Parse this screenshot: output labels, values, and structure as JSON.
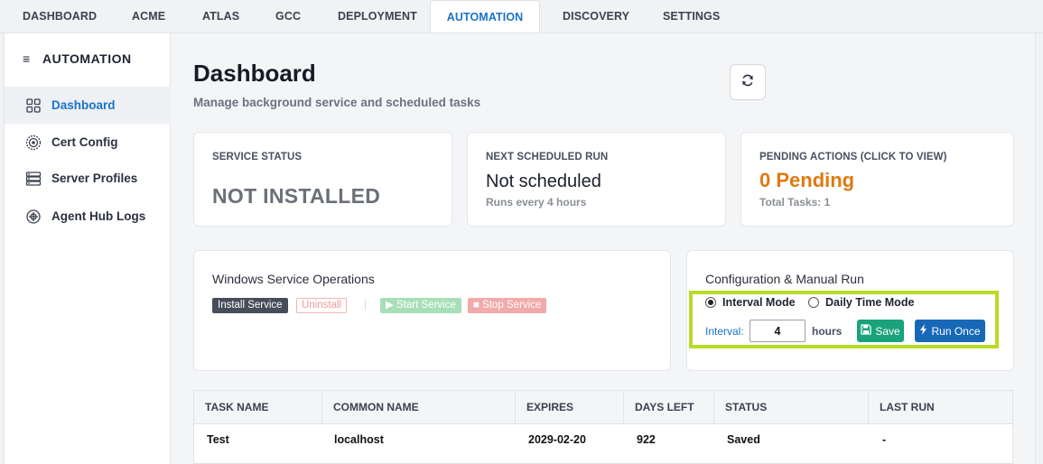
{
  "topnav": {
    "tabs": [
      {
        "label": "DASHBOARD"
      },
      {
        "label": "ACME"
      },
      {
        "label": "ATLAS"
      },
      {
        "label": "GCC"
      },
      {
        "label": "DEPLOYMENT"
      },
      {
        "label": "AUTOMATION",
        "active": true
      },
      {
        "label": "DISCOVERY"
      },
      {
        "label": "SETTINGS"
      }
    ]
  },
  "sidebar": {
    "title": "AUTOMATION",
    "items": [
      {
        "label": "Dashboard",
        "icon": "grid-icon",
        "active": true
      },
      {
        "label": "Cert Config",
        "icon": "certificate-icon"
      },
      {
        "label": "Server Profiles",
        "icon": "server-icon"
      },
      {
        "label": "Agent Hub Logs",
        "icon": "logs-icon"
      }
    ]
  },
  "header": {
    "title": "Dashboard",
    "subtitle": "Manage background service and scheduled tasks"
  },
  "stats": {
    "service": {
      "label": "SERVICE STATUS",
      "value": "NOT INSTALLED"
    },
    "next_run": {
      "label": "NEXT SCHEDULED RUN",
      "value": "Not scheduled",
      "sub": "Runs every 4 hours"
    },
    "pending": {
      "label": "PENDING ACTIONS (CLICK TO VIEW)",
      "value": "0 Pending",
      "sub": "Total Tasks: 1"
    }
  },
  "service_ops": {
    "title": "Windows Service Operations",
    "install": "Install Service",
    "uninstall": "Uninstall",
    "separator": "|",
    "start": "Start Service",
    "stop": "Stop Service"
  },
  "config": {
    "title": "Configuration & Manual Run",
    "mode_interval": "Interval Mode",
    "mode_daily": "Daily Time Mode",
    "selected_mode": "Interval Mode",
    "interval_label": "Interval:",
    "interval_value": "4",
    "unit": "hours",
    "save": "Save",
    "run_once": "Run Once"
  },
  "table": {
    "headers": [
      "TASK NAME",
      "COMMON NAME",
      "EXPIRES",
      "DAYS LEFT",
      "STATUS",
      "LAST RUN"
    ],
    "rows": [
      [
        "Test",
        "localhost",
        "2029-02-20",
        "922",
        "Saved",
        "-"
      ]
    ]
  },
  "colors": {
    "accent": "#1a73c8",
    "pending_orange": "#e07a10",
    "save_green": "#1aa37a",
    "run_blue": "#1769b8",
    "highlight": "#b8dc26"
  }
}
